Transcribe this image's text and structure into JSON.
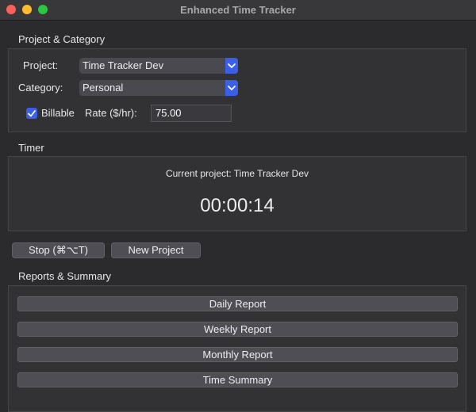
{
  "window": {
    "title": "Enhanced Time Tracker"
  },
  "project_category": {
    "section_label": "Project & Category",
    "project_label": "Project:",
    "project_value": "Time Tracker Dev",
    "category_label": "Category:",
    "category_value": "Personal",
    "billable_label": "Billable",
    "billable_checked": true,
    "rate_label": "Rate ($/hr):",
    "rate_value": "75.00"
  },
  "timer": {
    "section_label": "Timer",
    "current_project": "Current project: Time Tracker Dev",
    "elapsed": "00:00:14"
  },
  "actions": {
    "stop_label": "Stop (⌘⌥T)",
    "new_project_label": "New Project"
  },
  "reports": {
    "section_label": "Reports & Summary",
    "buttons": [
      "Daily Report",
      "Weekly Report",
      "Monthly Report",
      "Time Summary"
    ]
  },
  "colors": {
    "accent": "#3b5fe8",
    "background": "#2b2a2d",
    "panel": "#323134"
  },
  "icons": {
    "select_arrow": "chevron-down-icon",
    "checkbox": "checkmark-icon"
  }
}
